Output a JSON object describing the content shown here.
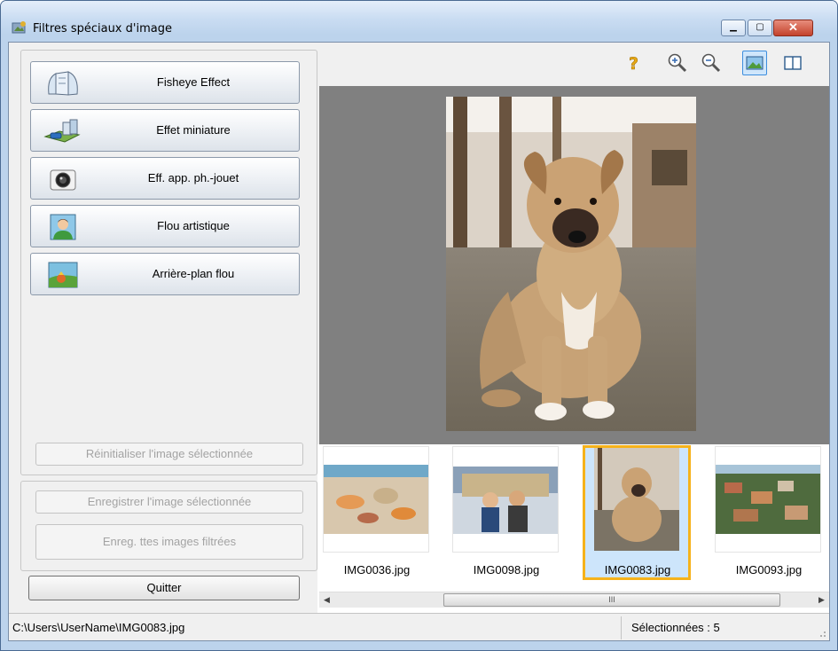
{
  "window": {
    "title": "Filtres spéciaux d'image"
  },
  "filters": [
    {
      "label": "Fisheye Effect",
      "icon": "fisheye-icon"
    },
    {
      "label": "Effet miniature",
      "icon": "miniature-icon"
    },
    {
      "label": "Eff. app. ph.-jouet",
      "icon": "toy-camera-icon"
    },
    {
      "label": "Flou artistique",
      "icon": "soft-focus-icon"
    },
    {
      "label": "Arrière-plan flou",
      "icon": "blur-background-icon"
    }
  ],
  "buttons": {
    "reset": "Réinitialiser l'image sélectionnée",
    "save_selected": "Enregistrer l'image sélectionnée",
    "save_all": "Enreg. ttes images filtrées",
    "quit": "Quitter"
  },
  "toolbar": {
    "tools": [
      "help-icon",
      "zoom-in-icon",
      "zoom-out-icon",
      "single-view-icon",
      "compare-view-icon"
    ]
  },
  "thumbnails": [
    {
      "name": "IMG0036.jpg",
      "selected": false
    },
    {
      "name": "IMG0098.jpg",
      "selected": false
    },
    {
      "name": "IMG0083.jpg",
      "selected": true
    },
    {
      "name": "IMG0093.jpg",
      "selected": false
    }
  ],
  "scrollbar": {
    "grip": "III"
  },
  "status": {
    "path": "C:\\Users\\UserName\\IMG0083.jpg",
    "selected_count": "Sélectionnées : 5"
  },
  "colors": {
    "selection": "#f6b21a",
    "preview_bg": "#808080"
  }
}
